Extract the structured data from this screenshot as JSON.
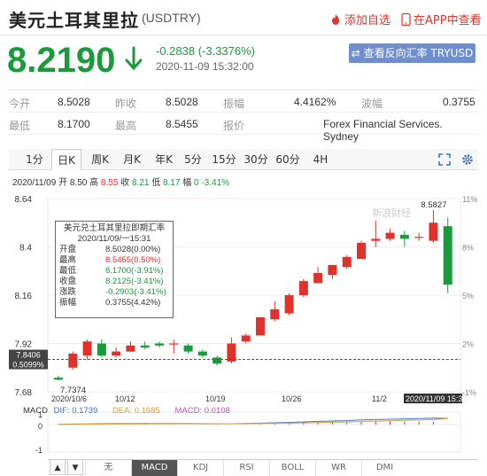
{
  "header": {
    "title": "美元土耳其里拉",
    "code": "(USDTRY)",
    "add_watch": "添加自选",
    "view_app": "在APP中查看"
  },
  "quote": {
    "price": "8.2190",
    "change": "-0.2838 (-3.3376%)",
    "time": "2020-11-09 15:32:00",
    "reverse_button": "查看反向汇率 TRYUSD",
    "color_down": "#1a9a3a",
    "color_up": "#e0312b"
  },
  "stats": {
    "row1": [
      {
        "label": "今开",
        "value": "8.5028"
      },
      {
        "label": "昨收",
        "value": "8.5028"
      },
      {
        "label": "振幅",
        "value": "4.4162%"
      },
      {
        "label": "波幅",
        "value": "0.3755"
      }
    ],
    "row2": [
      {
        "label": "最低",
        "value": "8.1700"
      },
      {
        "label": "最高",
        "value": "8.5455"
      },
      {
        "label": "报价",
        "value": "Forex Financial Services. Sydney"
      }
    ]
  },
  "tabs": [
    "1分",
    "日K",
    "周K",
    "月K",
    "年K",
    "5分",
    "15分",
    "30分",
    "60分",
    "4H"
  ],
  "active_tab": "日K",
  "ohlc_line": {
    "date": "2020/11/09",
    "open_label": "开",
    "open": "8.50",
    "high_label": "高",
    "high": "8.55",
    "close_label": "收",
    "close": "8.21",
    "low_label": "低",
    "low": "8.17",
    "pct_label": "幅",
    "pct": "0 -3.41%"
  },
  "tooltip": {
    "title": "美元兑土耳其里拉即期汇率",
    "date": "2020/11/09/一15:31",
    "rows": [
      {
        "k": "开盘",
        "v": "8.5028(0.00%)",
        "c": "#333333"
      },
      {
        "k": "最高",
        "v": "8.5455(0.50%)",
        "c": "#e0312b"
      },
      {
        "k": "最低",
        "v": "8.1700(-3.91%)",
        "c": "#1a9a3a"
      },
      {
        "k": "收盘",
        "v": "8.2125(-3.41%)",
        "c": "#1a9a3a"
      },
      {
        "k": "涨跌",
        "v": "-0.2903(-3.41%)",
        "c": "#1a9a3a"
      },
      {
        "k": "振幅",
        "v": "0.3755(4.42%)",
        "c": "#333333"
      }
    ]
  },
  "chart_data": {
    "type": "candlestick",
    "y_ticks": [
      "8.64",
      "8.4",
      "8.16",
      "7.92",
      "7.68"
    ],
    "y_range": [
      7.68,
      8.64
    ],
    "right_pct_ticks": [
      "11%",
      "8%",
      "5%",
      "2%",
      "-1%"
    ],
    "x_labels": [
      "2020/10/6",
      "10/12",
      "10/19",
      "10/26",
      "11/2",
      "2020/11/09 15:31"
    ],
    "crosshair_price": "7.8406",
    "crosshair_pct": "0.5099%",
    "max_label": "8.5827",
    "min_label": "7.7374",
    "watermark": "新浪财经",
    "candles": [
      {
        "o": 7.75,
        "c": 7.74,
        "h": 7.76,
        "l": 7.7374
      },
      {
        "o": 7.8,
        "c": 7.87,
        "h": 7.88,
        "l": 7.79
      },
      {
        "o": 7.86,
        "c": 7.93,
        "h": 7.94,
        "l": 7.84
      },
      {
        "o": 7.92,
        "c": 7.86,
        "h": 7.94,
        "l": 7.85
      },
      {
        "o": 7.86,
        "c": 7.88,
        "h": 7.9,
        "l": 7.85
      },
      {
        "o": 7.88,
        "c": 7.91,
        "h": 7.93,
        "l": 7.88
      },
      {
        "o": 7.91,
        "c": 7.9,
        "h": 7.93,
        "l": 7.89
      },
      {
        "o": 7.92,
        "c": 7.91,
        "h": 7.93,
        "l": 7.9
      },
      {
        "o": 7.92,
        "c": 7.92,
        "h": 7.94,
        "l": 7.87
      },
      {
        "o": 7.91,
        "c": 7.88,
        "h": 7.92,
        "l": 7.87
      },
      {
        "o": 7.88,
        "c": 7.86,
        "h": 7.89,
        "l": 7.85
      },
      {
        "o": 7.85,
        "c": 7.82,
        "h": 7.86,
        "l": 7.81
      },
      {
        "o": 7.83,
        "c": 7.92,
        "h": 7.95,
        "l": 7.82
      },
      {
        "o": 7.93,
        "c": 7.96,
        "h": 7.97,
        "l": 7.92
      },
      {
        "o": 7.96,
        "c": 8.05,
        "h": 8.05,
        "l": 7.96
      },
      {
        "o": 8.04,
        "c": 8.09,
        "h": 8.13,
        "l": 8.03
      },
      {
        "o": 8.07,
        "c": 8.16,
        "h": 8.17,
        "l": 8.06
      },
      {
        "o": 8.16,
        "c": 8.23,
        "h": 8.24,
        "l": 8.15
      },
      {
        "o": 8.22,
        "c": 8.27,
        "h": 8.3,
        "l": 8.22
      },
      {
        "o": 8.26,
        "c": 8.31,
        "h": 8.31,
        "l": 8.24
      },
      {
        "o": 8.3,
        "c": 8.35,
        "h": 8.36,
        "l": 8.29
      },
      {
        "o": 8.34,
        "c": 8.42,
        "h": 8.43,
        "l": 8.34
      },
      {
        "o": 8.43,
        "c": 8.44,
        "h": 8.53,
        "l": 8.4
      },
      {
        "o": 8.44,
        "c": 8.47,
        "h": 8.49,
        "l": 8.43
      },
      {
        "o": 8.46,
        "c": 8.44,
        "h": 8.48,
        "l": 8.4
      },
      {
        "o": 8.45,
        "c": 8.45,
        "h": 8.47,
        "l": 8.43
      },
      {
        "o": 8.43,
        "c": 8.52,
        "h": 8.5827,
        "l": 8.42
      },
      {
        "o": 8.5028,
        "c": 8.2125,
        "h": 8.5455,
        "l": 8.17
      }
    ],
    "macd": {
      "dif_label": "DIF:",
      "dif": "0.1739",
      "dea_label": "DEA:",
      "dea": "0.1685",
      "macd_label": "MACD:",
      "macd": "0.0108",
      "y_ticks": [
        "1",
        "0",
        "-1"
      ],
      "dif_color": "#3b73c9",
      "dea_color": "#d9a040",
      "macd_color": "#c050c0",
      "dif_values": [
        0.01,
        0.015,
        0.02,
        0.025,
        0.027,
        0.028,
        0.029,
        0.03,
        0.03,
        0.029,
        0.026,
        0.022,
        0.024,
        0.03,
        0.04,
        0.05,
        0.06,
        0.075,
        0.09,
        0.1,
        0.11,
        0.13,
        0.14,
        0.15,
        0.16,
        0.17,
        0.18,
        0.1739
      ],
      "dea_values": [
        0.008,
        0.01,
        0.013,
        0.016,
        0.019,
        0.021,
        0.023,
        0.025,
        0.026,
        0.027,
        0.027,
        0.026,
        0.026,
        0.027,
        0.03,
        0.034,
        0.04,
        0.047,
        0.055,
        0.064,
        0.073,
        0.084,
        0.095,
        0.106,
        0.117,
        0.128,
        0.14,
        0.1685
      ],
      "hist_values": [
        0.004,
        0.01,
        0.014,
        0.018,
        0.016,
        0.014,
        0.012,
        0.01,
        0.008,
        0.004,
        -0.002,
        -0.008,
        -0.004,
        0.006,
        0.02,
        0.032,
        0.04,
        0.056,
        0.07,
        0.072,
        0.074,
        0.092,
        0.09,
        0.088,
        0.086,
        0.084,
        0.08,
        0.0108
      ]
    }
  },
  "bottom_tabs": [
    "无",
    "MACD",
    "KDJ",
    "RSI",
    "BOLL",
    "WR",
    "DMI"
  ],
  "active_bottom_tab": "MACD",
  "nav": {
    "up": "▲",
    "down": "▼"
  }
}
